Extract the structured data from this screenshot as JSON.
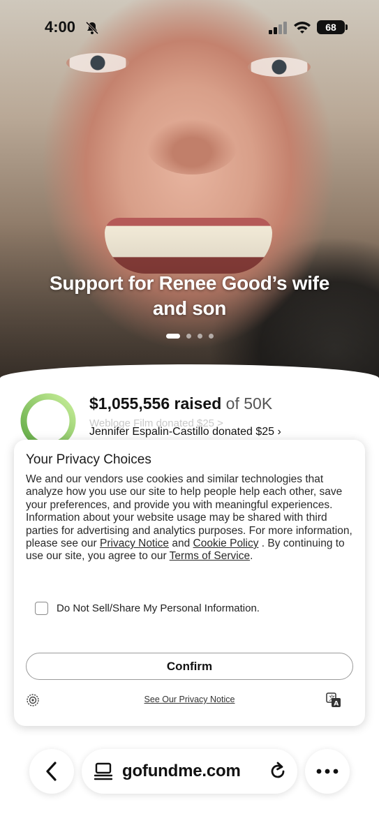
{
  "status_bar": {
    "time": "4:00",
    "battery": "68"
  },
  "hero": {
    "title": "Support for Renee Good’s wife and son",
    "carousel": {
      "count": 4,
      "active_index": 0
    }
  },
  "fundraiser": {
    "amount_raised": "$1,055,556 raised",
    "goal": " of 50K",
    "progress_fraction": 1.0,
    "ring_colors": {
      "start": "#5fa843",
      "end": "#c9ef9a"
    },
    "previous_donation": "Webloge Film donated $25 >",
    "latest_donation": "Jennifer Espalin-Castillo donated $25 ›"
  },
  "privacy_modal": {
    "title": "Your Privacy Choices",
    "body_start": "We and our vendors use cookies and similar technologies that analyze how you use our site to help people help each other, save your preferences, and provide you with meaningful experiences. Information about your website usage may be shared with third parties for advertising and analytics purposes. For more information, please see our ",
    "privacy_notice_link": "Privacy Notice",
    "and_text": " and ",
    "cookie_policy_link": "Cookie Policy",
    "body_middle": " . By continuing to use our site, you agree to our ",
    "terms_link": "Terms of Service",
    "body_end": ".",
    "optout_label": "Do Not Sell/Share My Personal Information.",
    "optout_checked": false,
    "confirm_label": "Confirm",
    "footer_link": "See Our Privacy Notice",
    "footer_icons": [
      "privacy-settings-icon",
      "translate-icon"
    ]
  },
  "browser": {
    "url": "gofundme.com",
    "icons": [
      "back-chevron-icon",
      "page-menu-icon",
      "reload-icon",
      "more-icon"
    ]
  }
}
